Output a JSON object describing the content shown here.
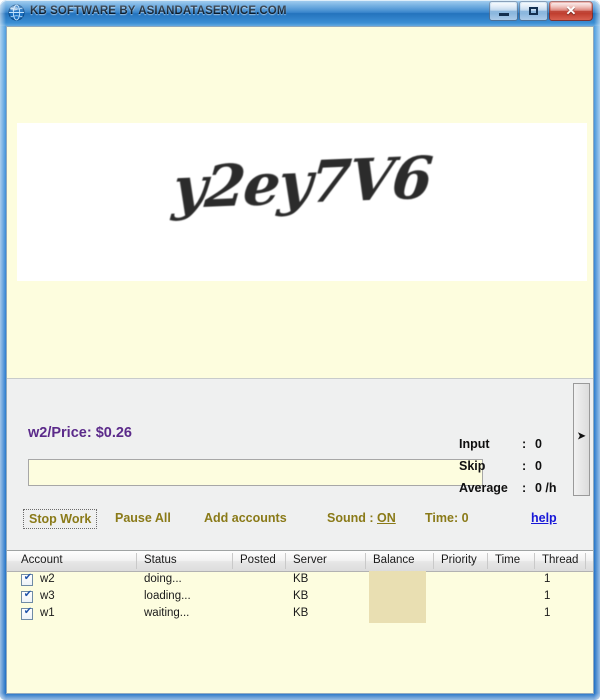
{
  "window": {
    "title": "KB SOFTWARE BY ASIANDATASERVICE.COM",
    "icon": "globe-icon",
    "minimize_label": "",
    "maximize_label": "",
    "close_label": "✕",
    "frame_color": "#2e7fc9",
    "client_bg": "#fdfdde"
  },
  "captcha": {
    "text": "y2ey7V6",
    "panel_bg": "#fdfdde",
    "image_bg": "#ffffff"
  },
  "work": {
    "price_label": "w2/Price: $0.26",
    "price_color": "#5b2a8a",
    "answer_value": "",
    "answer_placeholder": "",
    "stats": [
      {
        "key": "Input",
        "colon": ":",
        "value": "0"
      },
      {
        "key": "Skip",
        "colon": ":",
        "value": "0"
      },
      {
        "key": "Average",
        "colon": ":",
        "value": "0 /h"
      }
    ],
    "splitter_arrow": "➤"
  },
  "toolbar": {
    "stop_work": "Stop Work",
    "pause_all": "Pause All",
    "add_accounts": "Add accounts",
    "sound_prefix": "Sound : ",
    "sound_state": "ON",
    "time": "Time: 0",
    "help": "help",
    "item_color": "#8a7a18",
    "link_color": "#1717d8"
  },
  "table": {
    "columns": [
      "Account",
      "Status",
      "Posted",
      "Server",
      "Balance",
      "Priority",
      "Time",
      "Thread"
    ],
    "rows": [
      {
        "account": "w2",
        "checked": true,
        "status": "doing...",
        "posted": "",
        "server": "KB",
        "balance": "",
        "priority": "",
        "time": "",
        "thread": "1"
      },
      {
        "account": "w3",
        "checked": true,
        "status": "loading...",
        "posted": "",
        "server": "KB",
        "balance": "",
        "priority": "",
        "time": "",
        "thread": "1"
      },
      {
        "account": "w1",
        "checked": true,
        "status": "waiting...",
        "posted": "",
        "server": "KB",
        "balance": "",
        "priority": "",
        "time": "",
        "thread": "1"
      }
    ],
    "balance_highlight_color": "#e9dfb2",
    "row_bg": "#fdfddf"
  }
}
